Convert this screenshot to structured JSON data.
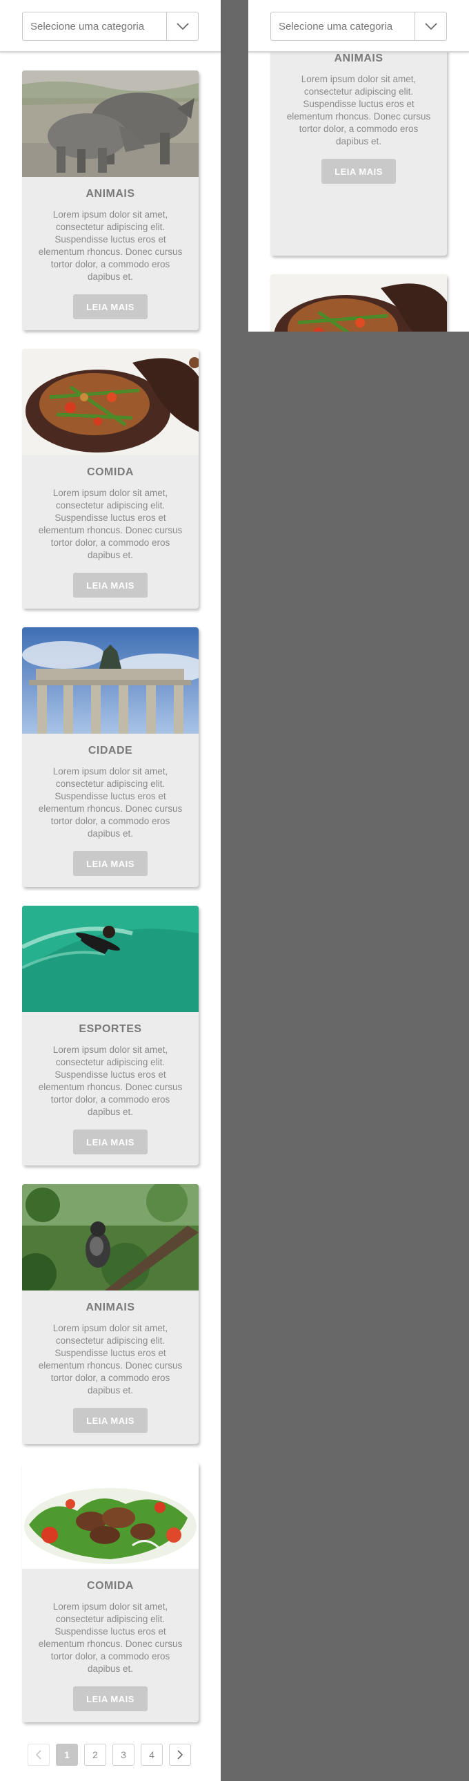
{
  "category_select": {
    "placeholder": "Selecione uma categoria"
  },
  "cards": [
    {
      "title": "ANIMAIS",
      "text": "Lorem ipsum dolor sit amet, consectetur adipiscing elit. Suspendisse luctus eros et elementum rhoncus. Donec cursus tortor dolor, a commodo eros dapibus et.",
      "button": "LEIA MAIS",
      "image": "rhinoceros-photo"
    },
    {
      "title": "COMIDA",
      "text": "Lorem ipsum dolor sit amet, consectetur adipiscing elit. Suspendisse luctus eros et elementum rhoncus. Donec cursus tortor dolor, a commodo eros dapibus et.",
      "button": "LEIA MAIS",
      "image": "stew-pot-photo"
    },
    {
      "title": "CIDADE",
      "text": "Lorem ipsum dolor sit amet, consectetur adipiscing elit. Suspendisse luctus eros et elementum rhoncus. Donec cursus tortor dolor, a commodo eros dapibus et.",
      "button": "LEIA MAIS",
      "image": "brandenburg-gate-photo"
    },
    {
      "title": "ESPORTES",
      "text": "Lorem ipsum dolor sit amet, consectetur adipiscing elit. Suspendisse luctus eros et elementum rhoncus. Donec cursus tortor dolor, a commodo eros dapibus et.",
      "button": "LEIA MAIS",
      "image": "surfer-photo"
    },
    {
      "title": "ANIMAIS",
      "text": "Lorem ipsum dolor sit amet, consectetur adipiscing elit. Suspendisse luctus eros et elementum rhoncus. Donec cursus tortor dolor, a commodo eros dapibus et.",
      "button": "LEIA MAIS",
      "image": "gorilla-photo"
    },
    {
      "title": "COMIDA",
      "text": "Lorem ipsum dolor sit amet, consectetur adipiscing elit. Suspendisse luctus eros et elementum rhoncus. Donec cursus tortor dolor, a commodo eros dapibus et.",
      "button": "LEIA MAIS",
      "image": "beef-salad-photo"
    }
  ],
  "pagination": {
    "prev": "‹",
    "pages": [
      "1",
      "2",
      "3",
      "4"
    ],
    "current": "1",
    "next": "›"
  },
  "colors": {
    "backdrop": "#686868",
    "card": "#ececec",
    "button": "#c9c9c9",
    "title": "#7a7a7a"
  }
}
